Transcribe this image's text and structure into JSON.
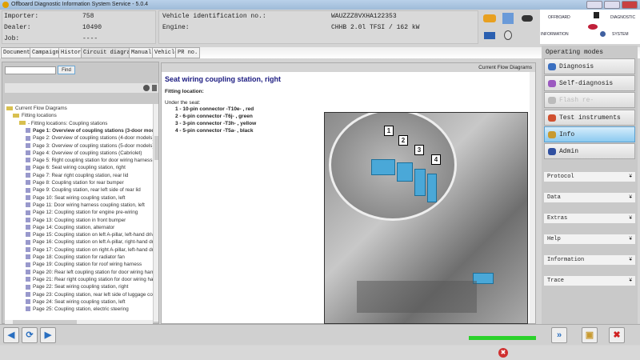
{
  "window": {
    "title": "Offboard Diagnostic Information System Service - 5.0.4"
  },
  "header": {
    "importer_label": "Importer:",
    "importer_value": "758",
    "dealer_label": "Dealer:",
    "dealer_value": "10490",
    "job_label": "Job:",
    "job_value": "----",
    "vin_label": "Vehicle identification no.:",
    "vin_value": "WAUZZZ8VXHA122353",
    "engine_label": "Engine:",
    "engine_value": "CHHB 2.0l TFSI / 162 kW",
    "logo_text": [
      "OFFBOARD",
      "DIAGNOSTIC",
      "INFORMATION",
      "SYSTEM"
    ]
  },
  "tabs": [
    {
      "label": "Documents"
    },
    {
      "label": "Campaigns"
    },
    {
      "label": "History"
    },
    {
      "label": "Circuit diagrams",
      "active": true
    },
    {
      "label": "Manuals"
    },
    {
      "label": "Vehicle"
    },
    {
      "label": "PR no."
    }
  ],
  "left": {
    "search_value": "",
    "find_label": "Find",
    "tree": [
      {
        "label": "Current Flow Diagrams",
        "level": 0,
        "type": "folder"
      },
      {
        "label": "Fitting locations",
        "level": 1,
        "type": "folder"
      },
      {
        "label": "- Fitting locations: Coupling stations",
        "level": 2,
        "type": "folder"
      },
      {
        "label": "Page 1: Overview of coupling stations (3-door mod",
        "level": 3,
        "bold": true
      },
      {
        "label": "Page 2: Overview of coupling stations (4-door models)",
        "level": 3
      },
      {
        "label": "Page 3: Overview of coupling stations (5-door models)",
        "level": 3
      },
      {
        "label": "Page 4: Overview of coupling stations (Cabriolet)",
        "level": 3
      },
      {
        "label": "Page 5: Right coupling station for door wiring harness",
        "level": 3
      },
      {
        "label": "Page 6: Seat wiring coupling station, right",
        "level": 3
      },
      {
        "label": "Page 7: Rear right coupling station, rear lid",
        "level": 3
      },
      {
        "label": "Page 8: Coupling station for rear bumper",
        "level": 3
      },
      {
        "label": "Page 9: Coupling station, rear left side of rear lid",
        "level": 3
      },
      {
        "label": "Page 10: Seat wiring coupling station, left",
        "level": 3
      },
      {
        "label": "Page 11: Door wiring harness coupling station, left",
        "level": 3
      },
      {
        "label": "Page 12: Coupling station for engine pre-wiring",
        "level": 3
      },
      {
        "label": "Page 13: Coupling station in front bumper",
        "level": 3
      },
      {
        "label": "Page 14: Coupling station, alternator",
        "level": 3
      },
      {
        "label": "Page 15: Coupling station on left A-pillar, left-hand driv",
        "level": 3
      },
      {
        "label": "Page 16: Coupling station on left A-pillar, right-hand dr",
        "level": 3
      },
      {
        "label": "Page 17: Coupling station on right A-pillar, left-hand dr",
        "level": 3
      },
      {
        "label": "Page 18: Coupling station for radiator fan",
        "level": 3
      },
      {
        "label": "Page 19: Coupling station for roof wiring harness",
        "level": 3
      },
      {
        "label": "Page 20: Rear left coupling station for door wiring harn",
        "level": 3
      },
      {
        "label": "Page 21: Rear right coupling station for door wiring har",
        "level": 3
      },
      {
        "label": "Page 22: Seat wiring coupling station, right",
        "level": 3
      },
      {
        "label": "Page 23: Coupling station, rear left side of luggage com",
        "level": 3
      },
      {
        "label": "Page 24: Seat wiring coupling station, left",
        "level": 3
      },
      {
        "label": "Page 25: Coupling station, electric steering",
        "level": 3
      }
    ]
  },
  "document": {
    "panel_title": "Current Flow Diagrams",
    "title": "Seat wiring coupling station, right",
    "fitting_label": "Fitting location:",
    "under": "Under the seat:",
    "connectors": [
      "1 - 10-pin connector -T10e- , red",
      "2 - 6-pin connector -T6j- , green",
      "3 - 3-pin connector -T3h- , yellow",
      "4 - 5-pin connector -T5a- , black"
    ],
    "callouts": [
      "1",
      "2",
      "3",
      "4"
    ]
  },
  "right": {
    "section": "Operating modes",
    "modes": [
      {
        "label": "Diagnosis",
        "color": "#3a6fc0"
      },
      {
        "label": "Self-diagnosis",
        "color": "#9b59c0"
      },
      {
        "label": "Flash re-programming",
        "color": "#bbbbbb",
        "disabled": true
      },
      {
        "label": "Test instruments",
        "color": "#d05030"
      },
      {
        "label": "Info",
        "color": "#c89a30",
        "active": true
      },
      {
        "label": "Admin",
        "color": "#3050a0"
      }
    ],
    "accordions": [
      {
        "label": "Protocol"
      },
      {
        "label": "Data"
      },
      {
        "label": "Extras"
      },
      {
        "label": "Help"
      },
      {
        "label": "Information"
      },
      {
        "label": "Trace"
      }
    ]
  },
  "status": {
    "progress_percent": 100,
    "progress_color": "#2bd12b"
  }
}
